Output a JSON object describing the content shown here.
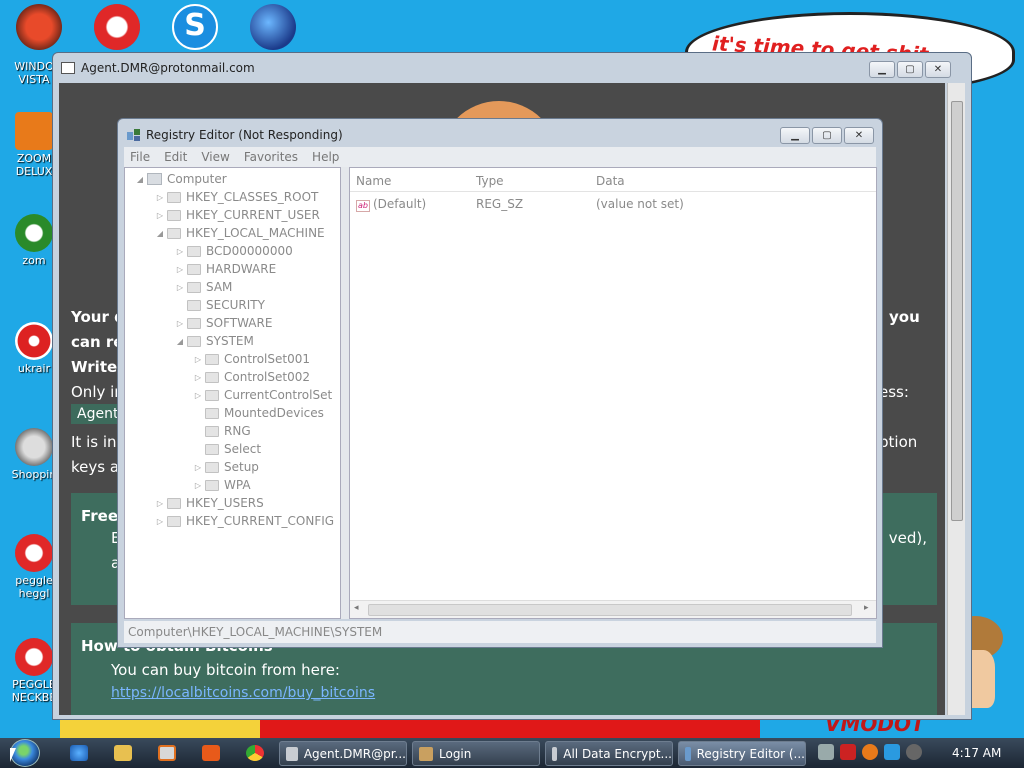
{
  "desktop": {
    "wallpaper_bubble_text": "it's time to get shit",
    "wallpaper_bottom_text": "VMODOT",
    "icons": [
      {
        "label_1": "WINDO",
        "label_2": "VISTA"
      },
      {
        "label_1": "ZOOM",
        "label_2": "DELUX"
      },
      {
        "label_1": "zom",
        "label_2": ""
      },
      {
        "label_1": "ukrair",
        "label_2": ""
      },
      {
        "label_1": "Shoppin",
        "label_2": ""
      },
      {
        "label_1": "peggle",
        "label_2": "heggl"
      },
      {
        "label_1": "PEGGLE",
        "label_2": "NECKBE"
      }
    ],
    "top_icons": [
      "windows-vista-icon",
      "peggle-icon",
      "skype-icon",
      "globe-icon"
    ]
  },
  "browser": {
    "title": "Agent.DMR@protonmail.com",
    "lines": {
      "line1_left": "Your d",
      "line1_right": "you",
      "line2_left": "can re",
      "line3_left": "Write",
      "line4_left": "Only in",
      "line4_right": "ess:",
      "email_chip": "Agent.",
      "line5_left": "It is in",
      "line5_right": "ption",
      "line6_left": "keys at"
    },
    "free_card": {
      "heading": "Free",
      "line1_left": "E",
      "line1_right": "ved),",
      "line2_left": "a"
    },
    "bitcoin_card": {
      "heading": "How to obtain Bitcoins",
      "text": "You can buy bitcoin from here:",
      "link": "https://localbitcoins.com/buy_bitcoins"
    }
  },
  "regedit": {
    "title": "Registry Editor (Not Responding)",
    "menu": [
      "File",
      "Edit",
      "View",
      "Favorites",
      "Help"
    ],
    "tree": [
      {
        "label": "Computer",
        "level": 0,
        "arrow": "◢",
        "icon": "computer"
      },
      {
        "label": "HKEY_CLASSES_ROOT",
        "level": 1,
        "arrow": "▷"
      },
      {
        "label": "HKEY_CURRENT_USER",
        "level": 1,
        "arrow": "▷"
      },
      {
        "label": "HKEY_LOCAL_MACHINE",
        "level": 1,
        "arrow": "◢"
      },
      {
        "label": "BCD00000000",
        "level": 2,
        "arrow": "▷"
      },
      {
        "label": "HARDWARE",
        "level": 2,
        "arrow": "▷"
      },
      {
        "label": "SAM",
        "level": 2,
        "arrow": "▷"
      },
      {
        "label": "SECURITY",
        "level": 2,
        "arrow": ""
      },
      {
        "label": "SOFTWARE",
        "level": 2,
        "arrow": "▷"
      },
      {
        "label": "SYSTEM",
        "level": 2,
        "arrow": "◢"
      },
      {
        "label": "ControlSet001",
        "level": 3,
        "arrow": "▷"
      },
      {
        "label": "ControlSet002",
        "level": 3,
        "arrow": "▷"
      },
      {
        "label": "CurrentControlSet",
        "level": 3,
        "arrow": "▷"
      },
      {
        "label": "MountedDevices",
        "level": 3,
        "arrow": ""
      },
      {
        "label": "RNG",
        "level": 3,
        "arrow": ""
      },
      {
        "label": "Select",
        "level": 3,
        "arrow": ""
      },
      {
        "label": "Setup",
        "level": 3,
        "arrow": "▷"
      },
      {
        "label": "WPA",
        "level": 3,
        "arrow": "▷"
      },
      {
        "label": "HKEY_USERS",
        "level": 1,
        "arrow": "▷"
      },
      {
        "label": "HKEY_CURRENT_CONFIG",
        "level": 1,
        "arrow": "▷"
      }
    ],
    "columns": {
      "name": "Name",
      "type": "Type",
      "data": "Data"
    },
    "values": [
      {
        "name": "(Default)",
        "type": "REG_SZ",
        "data": "(value not set)"
      }
    ],
    "status_path": "Computer\\HKEY_LOCAL_MACHINE\\SYSTEM"
  },
  "taskbar": {
    "tasks": [
      {
        "label": "Agent.DMR@pr...",
        "active": false
      },
      {
        "label": "Login",
        "active": false
      },
      {
        "label": "All Data Encrypt...",
        "active": false
      },
      {
        "label": "Registry Editor (...",
        "active": true
      }
    ],
    "clock": "4:17 AM"
  },
  "colors": {
    "desktop_bg": "#1fa8e6",
    "page_bg": "#4a4a4a",
    "card_bg": "#3e6d5e",
    "window_frame": "#c9d3df"
  }
}
